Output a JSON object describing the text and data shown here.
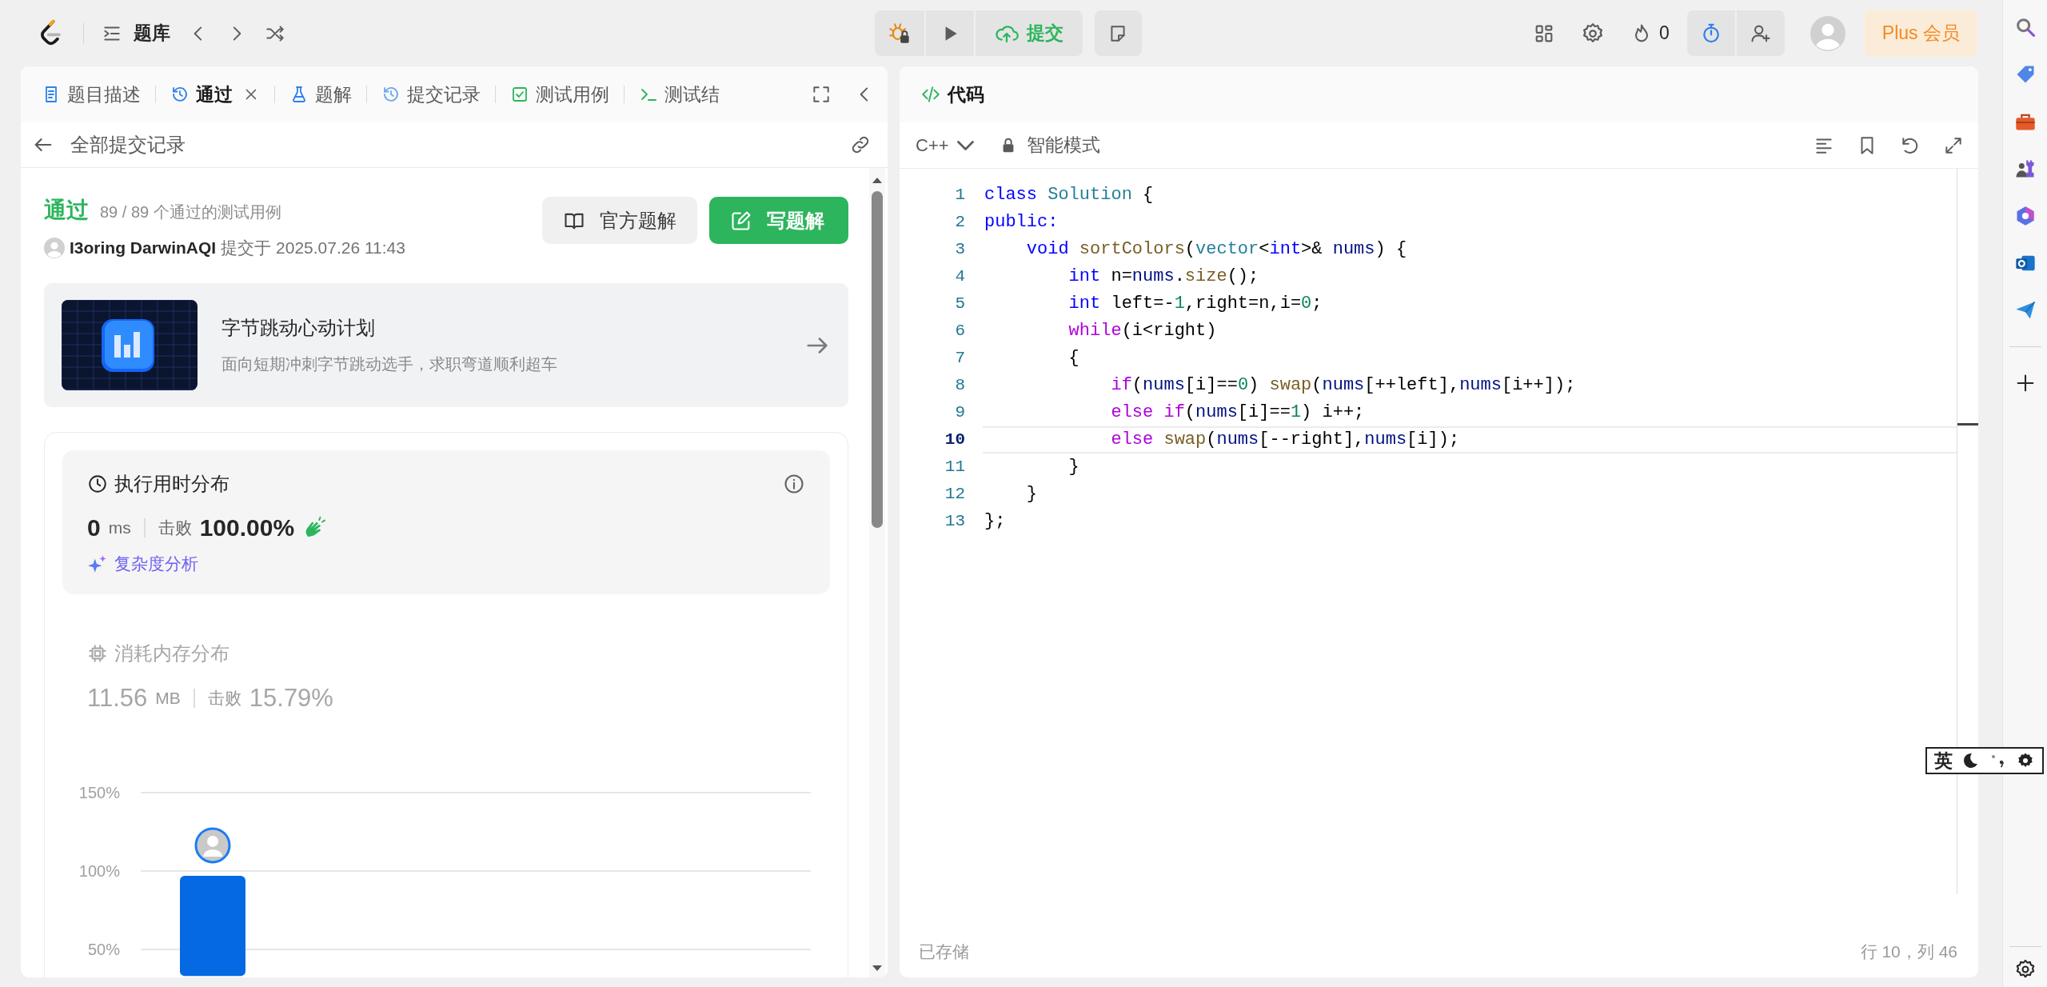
{
  "top_bar": {
    "problem_list": "题库",
    "submit": "提交",
    "streak_count": "0",
    "plus_button": "Plus 会员"
  },
  "left_panel": {
    "tabs": [
      {
        "label": "题目描述",
        "kind": "description",
        "selected": false,
        "closable": false
      },
      {
        "label": "通过",
        "kind": "submission",
        "selected": true,
        "closable": true
      },
      {
        "label": "题解",
        "kind": "solution",
        "selected": false,
        "closable": false
      },
      {
        "label": "提交记录",
        "kind": "history",
        "selected": false,
        "closable": false
      },
      {
        "label": "测试用例",
        "kind": "testcase",
        "selected": false,
        "closable": false
      },
      {
        "label": "测试结",
        "kind": "result",
        "selected": false,
        "closable": false
      }
    ],
    "back_link": "全部提交记录",
    "result": {
      "status": "通过",
      "cases": "89 / 89 个通过的测试用例",
      "user": "I3oring DarwinAQI",
      "submitted": "提交于 2025.07.26 11:43"
    },
    "buttons": [
      {
        "label": "官方题解",
        "kind": "secondary"
      },
      {
        "label": "写题解",
        "kind": "primary"
      }
    ],
    "banner": {
      "title": "字节跳动心动计划",
      "subtitle": "面向短期冲刺字节跳动选手，求职弯道顺利超车"
    },
    "distributions": [
      {
        "kind": "runtime",
        "title": "执行用时分布",
        "value": "0",
        "unit": "ms",
        "beats_label": "击败",
        "beats": "100.00%",
        "link": "复杂度分析",
        "selected": true
      },
      {
        "kind": "memory",
        "title": "消耗内存分布",
        "value": "11.56",
        "unit": "MB",
        "beats_label": "击败",
        "beats": "15.79%",
        "selected": false
      }
    ],
    "chart_data": {
      "type": "bar",
      "values": [
        97
      ],
      "ylim": [
        33,
        150
      ],
      "yticks": [
        {
          "value": 50,
          "label": "50%"
        },
        {
          "value": 100,
          "label": "100%"
        },
        {
          "value": 150,
          "label": "150%"
        }
      ]
    }
  },
  "code_panel": {
    "title": "代码",
    "language": "C++",
    "mode": "智能模式",
    "lines": [
      {
        "number": "1",
        "current": false,
        "tokens": [
          {
            "text": "class",
            "kind": "keyword"
          },
          {
            "text": " Solution",
            "kind": "type"
          },
          {
            "text": " {",
            "kind": "plain"
          }
        ]
      },
      {
        "number": "2",
        "current": false,
        "tokens": [
          {
            "text": "public:",
            "kind": "keyword"
          }
        ]
      },
      {
        "number": "3",
        "current": false,
        "tokens": [
          {
            "text": "    void",
            "kind": "keyword"
          },
          {
            "text": " sortColors",
            "kind": "function"
          },
          {
            "text": "(",
            "kind": "plain"
          },
          {
            "text": "vector",
            "kind": "type"
          },
          {
            "text": "<",
            "kind": "plain"
          },
          {
            "text": "int",
            "kind": "keyword"
          },
          {
            "text": ">& ",
            "kind": "plain"
          },
          {
            "text": "nums",
            "kind": "variable"
          },
          {
            "text": ") {",
            "kind": "plain"
          }
        ]
      },
      {
        "number": "4",
        "current": false,
        "tokens": [
          {
            "text": "        int",
            "kind": "keyword"
          },
          {
            "text": " n=",
            "kind": "plain"
          },
          {
            "text": "nums",
            "kind": "variable"
          },
          {
            "text": ".",
            "kind": "plain"
          },
          {
            "text": "size",
            "kind": "function"
          },
          {
            "text": "();",
            "kind": "plain"
          }
        ]
      },
      {
        "number": "5",
        "current": false,
        "tokens": [
          {
            "text": "        int",
            "kind": "keyword"
          },
          {
            "text": " left=-",
            "kind": "plain"
          },
          {
            "text": "1",
            "kind": "number"
          },
          {
            "text": ",right=n,i=",
            "kind": "plain"
          },
          {
            "text": "0",
            "kind": "number"
          },
          {
            "text": ";",
            "kind": "plain"
          }
        ]
      },
      {
        "number": "6",
        "current": false,
        "tokens": [
          {
            "text": "        while",
            "kind": "control"
          },
          {
            "text": "(i<right)",
            "kind": "plain"
          }
        ]
      },
      {
        "number": "7",
        "current": false,
        "tokens": [
          {
            "text": "        {",
            "kind": "plain"
          }
        ]
      },
      {
        "number": "8",
        "current": false,
        "tokens": [
          {
            "text": "            if",
            "kind": "control"
          },
          {
            "text": "(",
            "kind": "plain"
          },
          {
            "text": "nums",
            "kind": "variable"
          },
          {
            "text": "[i]==",
            "kind": "plain"
          },
          {
            "text": "0",
            "kind": "number"
          },
          {
            "text": ") ",
            "kind": "plain"
          },
          {
            "text": "swap",
            "kind": "function"
          },
          {
            "text": "(",
            "kind": "plain"
          },
          {
            "text": "nums",
            "kind": "variable"
          },
          {
            "text": "[++left],",
            "kind": "plain"
          },
          {
            "text": "nums",
            "kind": "variable"
          },
          {
            "text": "[i++]);",
            "kind": "plain"
          }
        ]
      },
      {
        "number": "9",
        "current": false,
        "tokens": [
          {
            "text": "            else if",
            "kind": "control"
          },
          {
            "text": "(",
            "kind": "plain"
          },
          {
            "text": "nums",
            "kind": "variable"
          },
          {
            "text": "[i]==",
            "kind": "plain"
          },
          {
            "text": "1",
            "kind": "number"
          },
          {
            "text": ") i++;",
            "kind": "plain"
          }
        ]
      },
      {
        "number": "10",
        "current": true,
        "tokens": [
          {
            "text": "            else",
            "kind": "control"
          },
          {
            "text": " swap",
            "kind": "function"
          },
          {
            "text": "(",
            "kind": "plain"
          },
          {
            "text": "nums",
            "kind": "variable"
          },
          {
            "text": "[--right],",
            "kind": "plain"
          },
          {
            "text": "nums",
            "kind": "variable"
          },
          {
            "text": "[i]);",
            "kind": "plain"
          }
        ]
      },
      {
        "number": "11",
        "current": false,
        "tokens": [
          {
            "text": "        }",
            "kind": "plain"
          }
        ]
      },
      {
        "number": "12",
        "current": false,
        "tokens": [
          {
            "text": "    }",
            "kind": "plain"
          }
        ]
      },
      {
        "number": "13",
        "current": false,
        "tokens": [
          {
            "text": "};",
            "kind": "plain"
          }
        ]
      }
    ],
    "saved_status": "已存储",
    "cursor": "行 10，列 46"
  },
  "ime_toolbar": {
    "language": "英"
  }
}
